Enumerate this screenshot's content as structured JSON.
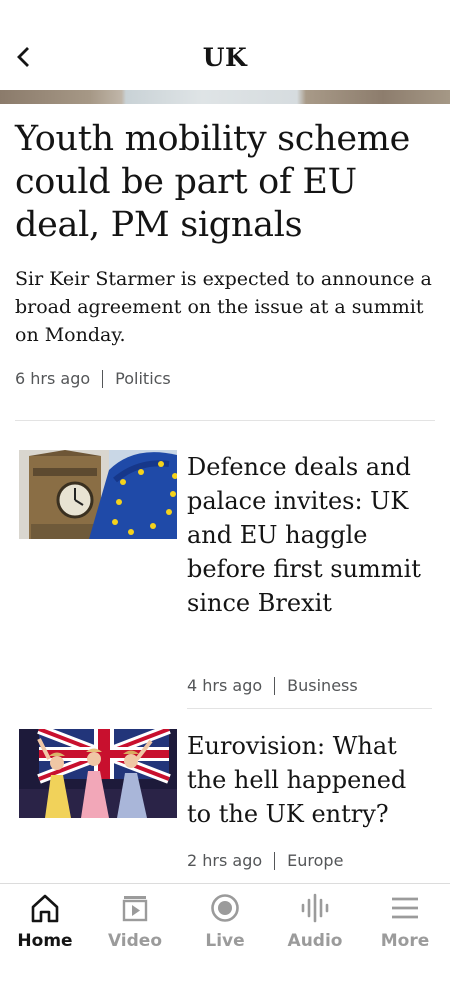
{
  "header": {
    "title": "UK",
    "back_icon": "chevron-left-icon"
  },
  "lead_story": {
    "headline": "Youth mobility scheme could be part of EU deal, PM signals",
    "summary": "Sir Keir Starmer is expected to announce a broad agreement on the issue at a summit on Monday.",
    "time": "6 hrs ago",
    "section": "Politics"
  },
  "stories": [
    {
      "headline": "Defence deals and palace invites: UK and EU haggle before first summit since Brexit",
      "time": "4 hrs ago",
      "section": "Business"
    },
    {
      "headline": "Eurovision: What the hell happened to the UK entry?",
      "time": "2 hrs ago",
      "section": "Europe"
    }
  ],
  "bottom_nav": {
    "items": [
      {
        "label": "Home",
        "icon": "home-icon",
        "active": true
      },
      {
        "label": "Video",
        "icon": "video-icon",
        "active": false
      },
      {
        "label": "Live",
        "icon": "live-icon",
        "active": false
      },
      {
        "label": "Audio",
        "icon": "audio-icon",
        "active": false
      },
      {
        "label": "More",
        "icon": "menu-icon",
        "active": false
      }
    ]
  },
  "colors": {
    "text": "#141414",
    "meta": "#545658",
    "inactive_nav": "#9b9b9b",
    "divider": "#e3e3e3"
  }
}
